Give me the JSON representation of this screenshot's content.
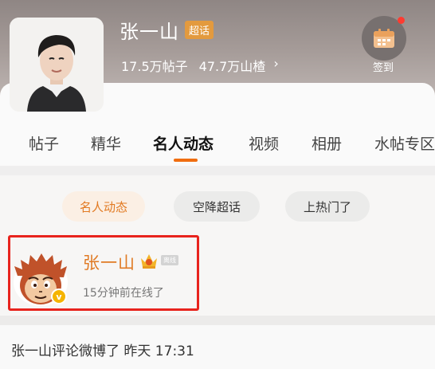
{
  "header": {
    "name": "张一山",
    "badge": "超话",
    "stats": {
      "posts_value": "17.5万",
      "posts_label": "帖子",
      "fans_value": "47.7万",
      "fans_label": "山楂"
    },
    "checkin_label": "签到"
  },
  "tabs": [
    {
      "label": "帖子"
    },
    {
      "label": "精华"
    },
    {
      "label": "名人动态"
    },
    {
      "label": "视频"
    },
    {
      "label": "相册"
    },
    {
      "label": "水帖专区"
    }
  ],
  "chips": [
    {
      "label": "名人动态"
    },
    {
      "label": "空降超话"
    },
    {
      "label": "上热门了"
    }
  ],
  "celebrity": {
    "name": "张一山",
    "level_tag": "离线",
    "status": "15分钟前在线了"
  },
  "activity": {
    "text": "张一山评论微博了 昨天 17:31"
  },
  "colors": {
    "accent": "#f06d10",
    "highlight_border": "#e8231d",
    "celebrity_name": "#e07a24",
    "badge": "#e39a3e"
  }
}
